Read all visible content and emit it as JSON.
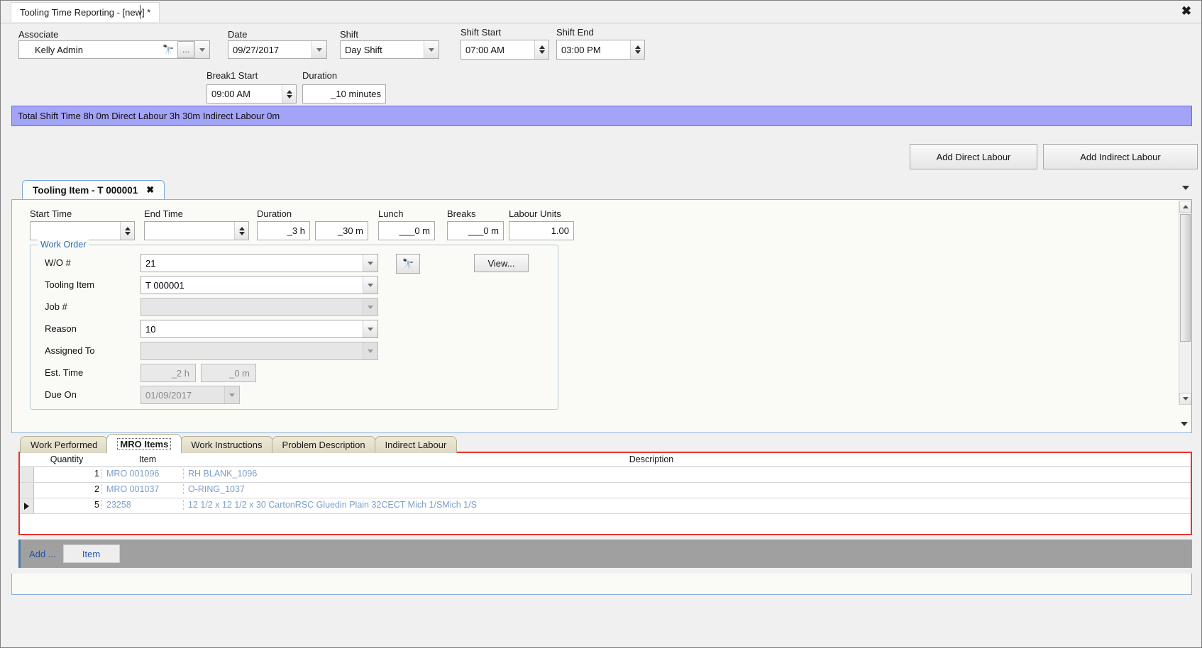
{
  "window": {
    "doc_tab_title": "Tooling Time Reporting - [new] *",
    "close_icon": "close-icon",
    "close_glyph": "✖"
  },
  "header": {
    "associate": {
      "label": "Associate",
      "value": "Kelly Admin",
      "search_icon": "binoculars-icon",
      "ellipsis_label": "...",
      "glyph": "🔭"
    },
    "date": {
      "label": "Date",
      "value": "09/27/2017"
    },
    "shift": {
      "label": "Shift",
      "value": "Day Shift"
    },
    "shift_start": {
      "label": "Shift Start",
      "value": "07:00 AM"
    },
    "shift_end": {
      "label": "Shift End",
      "value": "03:00 PM"
    },
    "break1_start": {
      "label": "Break1 Start",
      "value": "09:00 AM"
    },
    "break1_duration": {
      "label": "Duration",
      "value": "_10 minutes"
    }
  },
  "summary": {
    "text": "Total Shift Time 8h 0m  Direct Labour 3h 30m  Indirect Labour 0m"
  },
  "actions": {
    "add_direct_labour": "Add Direct Labour",
    "add_indirect_labour": "Add Indirect Labour"
  },
  "inner_tab": {
    "title": "Tooling Item - T 000001",
    "close_glyph": "✖"
  },
  "times": {
    "start_time": {
      "label": "Start Time",
      "value": ""
    },
    "end_time": {
      "label": "End Time",
      "value": ""
    },
    "duration": {
      "label": "Duration",
      "hours": "_3 h",
      "minutes": "_30 m"
    },
    "lunch": {
      "label": "Lunch",
      "value": "___0 m"
    },
    "breaks": {
      "label": "Breaks",
      "value": "___0 m"
    },
    "labour_units": {
      "label": "Labour Units",
      "value": "1.00"
    }
  },
  "work_order": {
    "group_title": "Work Order",
    "wo_number": {
      "label": "W/O #",
      "value": "21"
    },
    "tooling_item": {
      "label": "Tooling Item",
      "value": "T 000001"
    },
    "job_number": {
      "label": "Job #",
      "value": ""
    },
    "reason": {
      "label": "Reason",
      "value": "10"
    },
    "assigned_to": {
      "label": "Assigned To",
      "value": ""
    },
    "est_time": {
      "label": "Est. Time",
      "hours": "_2 h",
      "minutes": "_0 m"
    },
    "due_on": {
      "label": "Due On",
      "value": "01/09/2017"
    },
    "search_icon": "binoculars-icon",
    "search_glyph": "🔭",
    "view_button": "View..."
  },
  "lower_tabs": [
    {
      "label": "Work Performed",
      "active": false
    },
    {
      "label": "MRO Items",
      "active": true
    },
    {
      "label": "Work Instructions",
      "active": false
    },
    {
      "label": "Problem Description",
      "active": false
    },
    {
      "label": "Indirect Labour",
      "active": false
    }
  ],
  "grid": {
    "columns": [
      "Quantity",
      "Item",
      "Description"
    ],
    "rows": [
      {
        "quantity": "1",
        "item": "MRO 001096",
        "description": "RH BLANK_1096",
        "current": false
      },
      {
        "quantity": "2",
        "item": "MRO 001037",
        "description": "O-RING_1037",
        "current": false
      },
      {
        "quantity": "5",
        "item": "23258",
        "description": "12 1/2 x 12 1/2 x 30 CartonRSC Gluedin Plain 32CECT Mich 1/SMich 1/S",
        "current": true
      }
    ]
  },
  "addbar": {
    "add_label": "Add ...",
    "item_button": "Item"
  },
  "colors": {
    "summary_bg": "#a3a3f7",
    "grid_outline": "#e8332f",
    "link_blue": "#1b55a8",
    "grid_text": "#7b9fc9",
    "group_title": "#2d6fba"
  }
}
